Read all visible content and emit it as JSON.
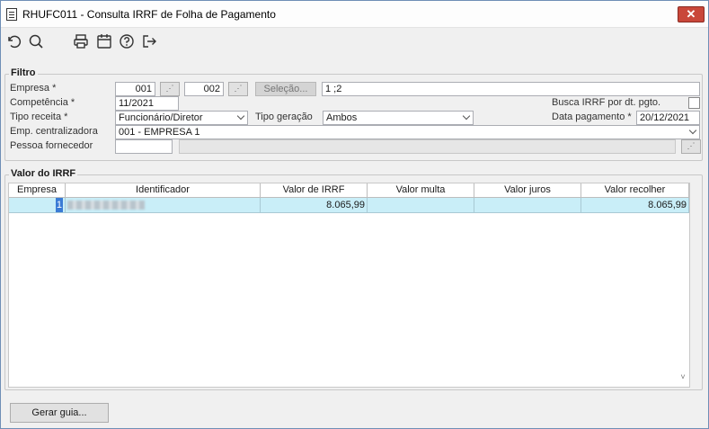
{
  "window": {
    "title": "RHUFC011 - Consulta IRRF de Folha de Pagamento",
    "close_label": "✕"
  },
  "toolbar": {
    "icons": [
      "undo-icon",
      "search-icon",
      "print-icon",
      "calendar-icon",
      "help-icon",
      "exit-icon"
    ]
  },
  "filtro": {
    "legend": "Filtro",
    "empresa_label": "Empresa *",
    "empresa_1": "001",
    "empresa_2": "002",
    "selecao_label": "Seleção...",
    "selecao_value": "1 ;2",
    "competencia_label": "Competência *",
    "competencia_value": "11/2021",
    "busca_label": "Busca IRRF por dt. pgto.",
    "tipo_receita_label": "Tipo receita *",
    "tipo_receita_value": "Funcionário/Diretor",
    "tipo_geracao_label": "Tipo geração",
    "tipo_geracao_value": "Ambos",
    "data_pagamento_label": "Data pagamento *",
    "data_pagamento_value": "20/12/2021",
    "emp_centralizadora_label": "Emp. centralizadora",
    "emp_centralizadora_value": "001 - EMPRESA 1",
    "pessoa_fornecedor_label": "Pessoa fornecedor",
    "pessoa_fornecedor_value": ""
  },
  "valor_irrf": {
    "legend": "Valor do IRRF",
    "columns": [
      "Empresa",
      "Identificador",
      "Valor de IRRF",
      "Valor multa",
      "Valor juros",
      "Valor recolher"
    ],
    "rows": [
      {
        "empresa": "1",
        "identificador": "",
        "valor_irrf": "8.065,99",
        "valor_multa": "",
        "valor_juros": "",
        "valor_recolher": "8.065,99"
      }
    ]
  },
  "footer": {
    "gerar_guia_label": "Gerar guia..."
  }
}
